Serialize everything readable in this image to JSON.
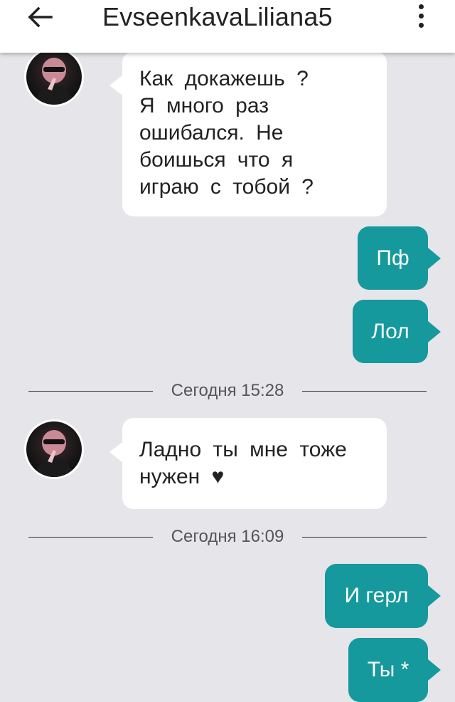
{
  "header": {
    "title": "EvseenkavaLiliana5"
  },
  "messages": {
    "m1": {
      "text": "Как  докажешь  ?\nЯ много  раз\nошибался.  Не\nбоишься  что  я\nиграю с  тобой  ?"
    },
    "m2": {
      "text": "Пф"
    },
    "m3": {
      "text": "Лол"
    },
    "d1": {
      "label": "Сегодня 15:28"
    },
    "m4": {
      "text": "Ладно  ты  мне  тоже\nнужен ♥"
    },
    "d2": {
      "label": "Сегодня 16:09"
    },
    "m5": {
      "text": "И герл"
    },
    "m6": {
      "text": "Ты *"
    }
  },
  "colors": {
    "background": "#e6e5e9",
    "outgoing_bubble": "#15999d",
    "incoming_bubble": "#ffffff"
  }
}
